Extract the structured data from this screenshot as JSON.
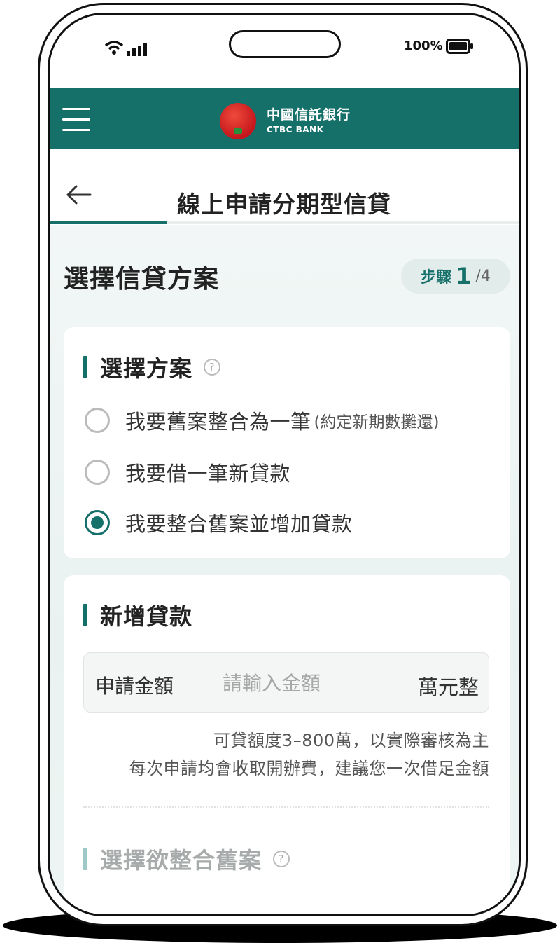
{
  "status_bar": {
    "battery_percent": "100%"
  },
  "header": {
    "bank_name_zh": "中國信託銀行",
    "bank_name_en": "CTBC BANK",
    "brand_color": "#15706a"
  },
  "title_bar": {
    "title": "線上申請分期型信貸",
    "progress": 0.25
  },
  "section": {
    "title": "選擇信貸方案",
    "step_label": "步驟",
    "step_current": "1",
    "step_total": "/4"
  },
  "plan_card": {
    "heading": "選擇方案",
    "options": [
      {
        "label": "我要舊案整合為一筆",
        "note": "(約定新期數攤還)",
        "checked": false
      },
      {
        "label": "我要借一筆新貸款",
        "note": "",
        "checked": false
      },
      {
        "label": "我要整合舊案並增加貸款",
        "note": "",
        "checked": true
      }
    ]
  },
  "loan_card": {
    "heading": "新增貸款",
    "amount_label": "申請金額",
    "amount_placeholder": "請輸入金額",
    "amount_unit": "萬元整",
    "note_1": "可貸額度3–800萬，以實際審核為主",
    "note_2": "每次申請均會收取開辦費，建議您一次借足金額",
    "next_heading": "選擇欲整合舊案"
  }
}
